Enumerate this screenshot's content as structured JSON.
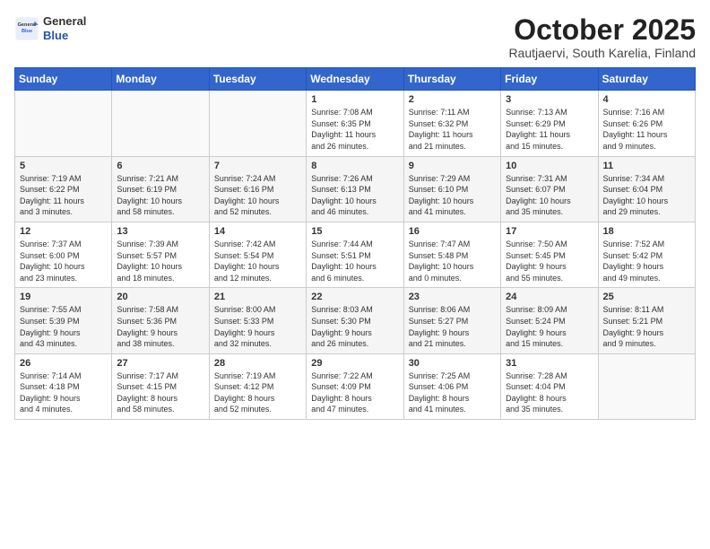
{
  "logo": {
    "general": "General",
    "blue": "Blue"
  },
  "header": {
    "month": "October 2025",
    "location": "Rautjaervi, South Karelia, Finland"
  },
  "weekdays": [
    "Sunday",
    "Monday",
    "Tuesday",
    "Wednesday",
    "Thursday",
    "Friday",
    "Saturday"
  ],
  "weeks": [
    [
      {
        "day": "",
        "info": ""
      },
      {
        "day": "",
        "info": ""
      },
      {
        "day": "",
        "info": ""
      },
      {
        "day": "1",
        "info": "Sunrise: 7:08 AM\nSunset: 6:35 PM\nDaylight: 11 hours\nand 26 minutes."
      },
      {
        "day": "2",
        "info": "Sunrise: 7:11 AM\nSunset: 6:32 PM\nDaylight: 11 hours\nand 21 minutes."
      },
      {
        "day": "3",
        "info": "Sunrise: 7:13 AM\nSunset: 6:29 PM\nDaylight: 11 hours\nand 15 minutes."
      },
      {
        "day": "4",
        "info": "Sunrise: 7:16 AM\nSunset: 6:26 PM\nDaylight: 11 hours\nand 9 minutes."
      }
    ],
    [
      {
        "day": "5",
        "info": "Sunrise: 7:19 AM\nSunset: 6:22 PM\nDaylight: 11 hours\nand 3 minutes."
      },
      {
        "day": "6",
        "info": "Sunrise: 7:21 AM\nSunset: 6:19 PM\nDaylight: 10 hours\nand 58 minutes."
      },
      {
        "day": "7",
        "info": "Sunrise: 7:24 AM\nSunset: 6:16 PM\nDaylight: 10 hours\nand 52 minutes."
      },
      {
        "day": "8",
        "info": "Sunrise: 7:26 AM\nSunset: 6:13 PM\nDaylight: 10 hours\nand 46 minutes."
      },
      {
        "day": "9",
        "info": "Sunrise: 7:29 AM\nSunset: 6:10 PM\nDaylight: 10 hours\nand 41 minutes."
      },
      {
        "day": "10",
        "info": "Sunrise: 7:31 AM\nSunset: 6:07 PM\nDaylight: 10 hours\nand 35 minutes."
      },
      {
        "day": "11",
        "info": "Sunrise: 7:34 AM\nSunset: 6:04 PM\nDaylight: 10 hours\nand 29 minutes."
      }
    ],
    [
      {
        "day": "12",
        "info": "Sunrise: 7:37 AM\nSunset: 6:00 PM\nDaylight: 10 hours\nand 23 minutes."
      },
      {
        "day": "13",
        "info": "Sunrise: 7:39 AM\nSunset: 5:57 PM\nDaylight: 10 hours\nand 18 minutes."
      },
      {
        "day": "14",
        "info": "Sunrise: 7:42 AM\nSunset: 5:54 PM\nDaylight: 10 hours\nand 12 minutes."
      },
      {
        "day": "15",
        "info": "Sunrise: 7:44 AM\nSunset: 5:51 PM\nDaylight: 10 hours\nand 6 minutes."
      },
      {
        "day": "16",
        "info": "Sunrise: 7:47 AM\nSunset: 5:48 PM\nDaylight: 10 hours\nand 0 minutes."
      },
      {
        "day": "17",
        "info": "Sunrise: 7:50 AM\nSunset: 5:45 PM\nDaylight: 9 hours\nand 55 minutes."
      },
      {
        "day": "18",
        "info": "Sunrise: 7:52 AM\nSunset: 5:42 PM\nDaylight: 9 hours\nand 49 minutes."
      }
    ],
    [
      {
        "day": "19",
        "info": "Sunrise: 7:55 AM\nSunset: 5:39 PM\nDaylight: 9 hours\nand 43 minutes."
      },
      {
        "day": "20",
        "info": "Sunrise: 7:58 AM\nSunset: 5:36 PM\nDaylight: 9 hours\nand 38 minutes."
      },
      {
        "day": "21",
        "info": "Sunrise: 8:00 AM\nSunset: 5:33 PM\nDaylight: 9 hours\nand 32 minutes."
      },
      {
        "day": "22",
        "info": "Sunrise: 8:03 AM\nSunset: 5:30 PM\nDaylight: 9 hours\nand 26 minutes."
      },
      {
        "day": "23",
        "info": "Sunrise: 8:06 AM\nSunset: 5:27 PM\nDaylight: 9 hours\nand 21 minutes."
      },
      {
        "day": "24",
        "info": "Sunrise: 8:09 AM\nSunset: 5:24 PM\nDaylight: 9 hours\nand 15 minutes."
      },
      {
        "day": "25",
        "info": "Sunrise: 8:11 AM\nSunset: 5:21 PM\nDaylight: 9 hours\nand 9 minutes."
      }
    ],
    [
      {
        "day": "26",
        "info": "Sunrise: 7:14 AM\nSunset: 4:18 PM\nDaylight: 9 hours\nand 4 minutes."
      },
      {
        "day": "27",
        "info": "Sunrise: 7:17 AM\nSunset: 4:15 PM\nDaylight: 8 hours\nand 58 minutes."
      },
      {
        "day": "28",
        "info": "Sunrise: 7:19 AM\nSunset: 4:12 PM\nDaylight: 8 hours\nand 52 minutes."
      },
      {
        "day": "29",
        "info": "Sunrise: 7:22 AM\nSunset: 4:09 PM\nDaylight: 8 hours\nand 47 minutes."
      },
      {
        "day": "30",
        "info": "Sunrise: 7:25 AM\nSunset: 4:06 PM\nDaylight: 8 hours\nand 41 minutes."
      },
      {
        "day": "31",
        "info": "Sunrise: 7:28 AM\nSunset: 4:04 PM\nDaylight: 8 hours\nand 35 minutes."
      },
      {
        "day": "",
        "info": ""
      }
    ]
  ]
}
